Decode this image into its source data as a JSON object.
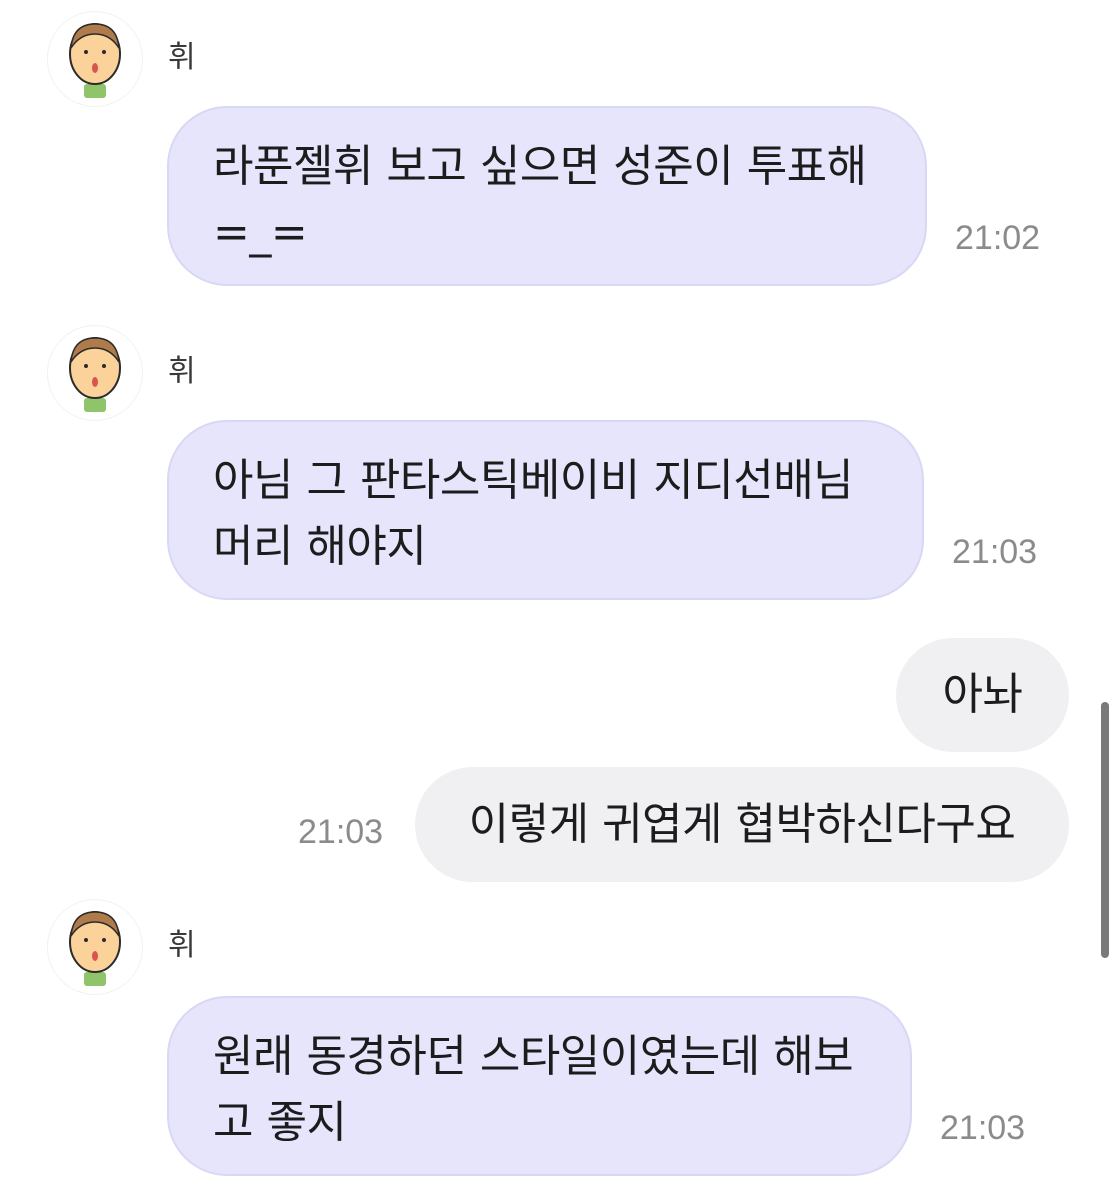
{
  "conversation": {
    "messages": [
      {
        "sender": "휘",
        "text": "라푼젤휘 보고 싶으면 성준이 투표해\n=_=",
        "time": "21:02"
      },
      {
        "sender": "휘",
        "text": "아님 그 판타스틱베이비 지디선배님\n머리 해야지",
        "time": "21:03"
      },
      {
        "text": "아놔"
      },
      {
        "text": "이렇게 귀엽게 협박하신다구요",
        "time": "21:03"
      },
      {
        "sender": "휘",
        "text": "원래 동경하던 스타일이였는데 해보\n고 좋지",
        "time": "21:03"
      }
    ]
  },
  "colors": {
    "incoming_bubble": "#e6e5fc",
    "outgoing_bubble": "#f0f0f3",
    "timestamp": "#8b8b8b"
  },
  "icons": {
    "avatar": "cartoon-boy-avatar-icon"
  }
}
